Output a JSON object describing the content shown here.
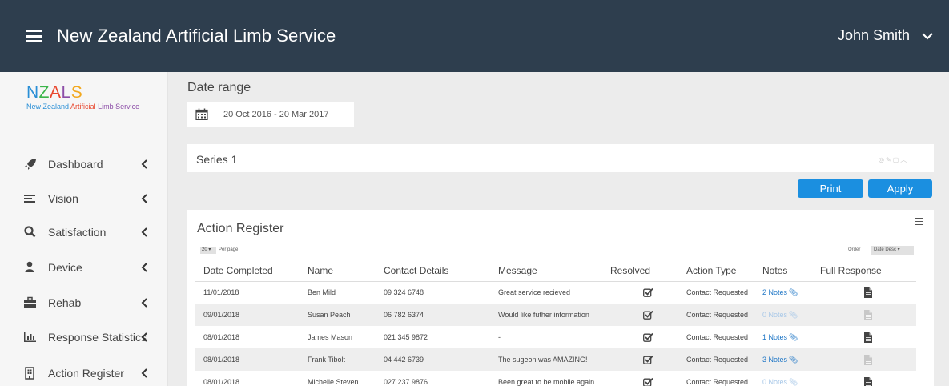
{
  "app": {
    "title": "New Zealand Artificial Limb Service",
    "user": "John Smith"
  },
  "logo": {
    "main": "NZALS",
    "sub_1": "New Zealand ",
    "sub_2": "Artificial ",
    "sub_3": "Limb Service"
  },
  "sidebar": {
    "items": [
      {
        "label": "Dashboard",
        "icon": "rocket-icon"
      },
      {
        "label": "Vision",
        "icon": "list-icon"
      },
      {
        "label": "Satisfaction",
        "icon": "search-icon"
      },
      {
        "label": "Device",
        "icon": "user-icon"
      },
      {
        "label": "Rehab",
        "icon": "briefcase-icon"
      },
      {
        "label": "Response Statistics",
        "icon": "bar-chart-icon"
      },
      {
        "label": "Action Register",
        "icon": "building-icon"
      }
    ]
  },
  "filters": {
    "date_range_label": "Date range",
    "date_range_value": "20 Oct 2016 - 20 Mar 2017"
  },
  "series": {
    "title": "Series 1"
  },
  "actions": {
    "print": "Print",
    "apply": "Apply"
  },
  "register": {
    "title": "Action Register",
    "per_page_value": "20",
    "per_page_label": "Per page",
    "order_label": "Order",
    "order_value": "Date Desc",
    "columns": [
      "Date Completed",
      "Name",
      "Contact Details",
      "Message",
      "Resolved",
      "Action Type",
      "Notes",
      "Full Response"
    ],
    "rows": [
      {
        "date": "11/01/2018",
        "name": "Ben Mild",
        "contact": "09 324 6748",
        "message": "Great service recieved",
        "resolved": true,
        "action_type": "Contact Requested",
        "notes": "2 Notes",
        "notes_active": true,
        "response_available": true
      },
      {
        "date": "09/01/2018",
        "name": "Susan Peach",
        "contact": "06 782 6374",
        "message": "Would like futher information",
        "resolved": true,
        "action_type": "Contact Requested",
        "notes": "0 Notes",
        "notes_active": false,
        "response_available": false
      },
      {
        "date": "08/01/2018",
        "name": "James Mason",
        "contact": "021 345 9872",
        "message": "-",
        "resolved": true,
        "action_type": "Contact Requested",
        "notes": "1 Notes",
        "notes_active": true,
        "response_available": true
      },
      {
        "date": "08/01/2018",
        "name": "Frank Tibolt",
        "contact": "04 442 6739",
        "message": "The sugeon was AMAZING!",
        "resolved": true,
        "action_type": "Contact Requested",
        "notes": "3 Notes",
        "notes_active": true,
        "response_available": false
      },
      {
        "date": "08/01/2018",
        "name": "Michelle Steven",
        "contact": "027 237 9876",
        "message": "Been great to be mobile again",
        "resolved": true,
        "action_type": "Contact Requested",
        "notes": "0 Notes",
        "notes_active": false,
        "response_available": true
      }
    ]
  },
  "colors": {
    "topbar": "#2e3e4e",
    "button": "#1b8fe0",
    "link": "#1e76c6"
  }
}
